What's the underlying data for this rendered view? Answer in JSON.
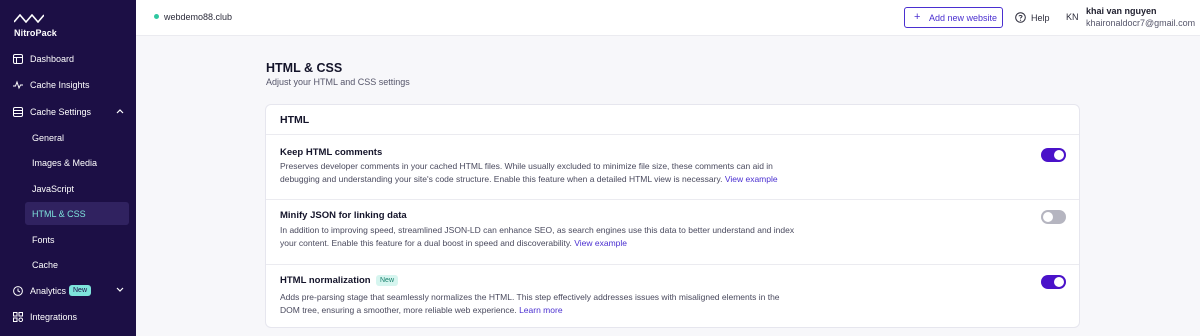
{
  "brand": {
    "logo_text": "NitroPack"
  },
  "sidebar": {
    "items": [
      {
        "label": "Dashboard",
        "icon": "dashboard-icon"
      },
      {
        "label": "Cache Insights",
        "icon": "pulse-icon"
      },
      {
        "label": "Cache Settings",
        "icon": "database-icon",
        "expanded": true
      },
      {
        "label": "Analytics",
        "icon": "clock-icon",
        "badge": "New"
      },
      {
        "label": "Integrations",
        "icon": "integrations-icon"
      }
    ],
    "subitems": [
      {
        "label": "General"
      },
      {
        "label": "Images & Media"
      },
      {
        "label": "JavaScript"
      },
      {
        "label": "HTML & CSS",
        "active": true
      },
      {
        "label": "Fonts"
      },
      {
        "label": "Cache"
      }
    ]
  },
  "topbar": {
    "site": "webdemo88.club",
    "add_site_label": "Add new website",
    "help_label": "Help",
    "user_initials": "KN",
    "user_name": "khai van nguyen",
    "user_email": "khaironaldocr7@gmail.com"
  },
  "page": {
    "title": "HTML & CSS",
    "subtitle": "Adjust your HTML and CSS settings"
  },
  "card": {
    "title": "HTML",
    "settings": [
      {
        "title": "Keep HTML comments",
        "desc_line1": "Preserves developer comments in your cached HTML files. While usually excluded to minimize file size, these comments can aid in",
        "desc_line2": "debugging and understanding your site's code structure. Enable this feature when a detailed HTML view is necessary.",
        "link": "View example",
        "enabled": true
      },
      {
        "title": "Minify JSON for linking data",
        "desc_line1": "In addition to improving speed, streamlined JSON-LD can enhance SEO, as search engines use this data to better understand and index",
        "desc_line2": "your content. Enable this feature for a dual boost in speed and discoverability.",
        "link": "View example",
        "enabled": false
      },
      {
        "title": "HTML normalization",
        "badge": "New",
        "desc_line1": "Adds pre-parsing stage that seamlessly normalizes the HTML. This step effectively addresses issues with misaligned elements in the",
        "desc_line2": "DOM tree, ensuring a smoother, more reliable web experience.",
        "link": "Learn more",
        "enabled": true
      }
    ]
  },
  "colors": {
    "sidebar_bg": "#1c0f45",
    "accent": "#4a12c9",
    "active_text": "#7ee4dc",
    "status_dot": "#2fc7a0"
  }
}
